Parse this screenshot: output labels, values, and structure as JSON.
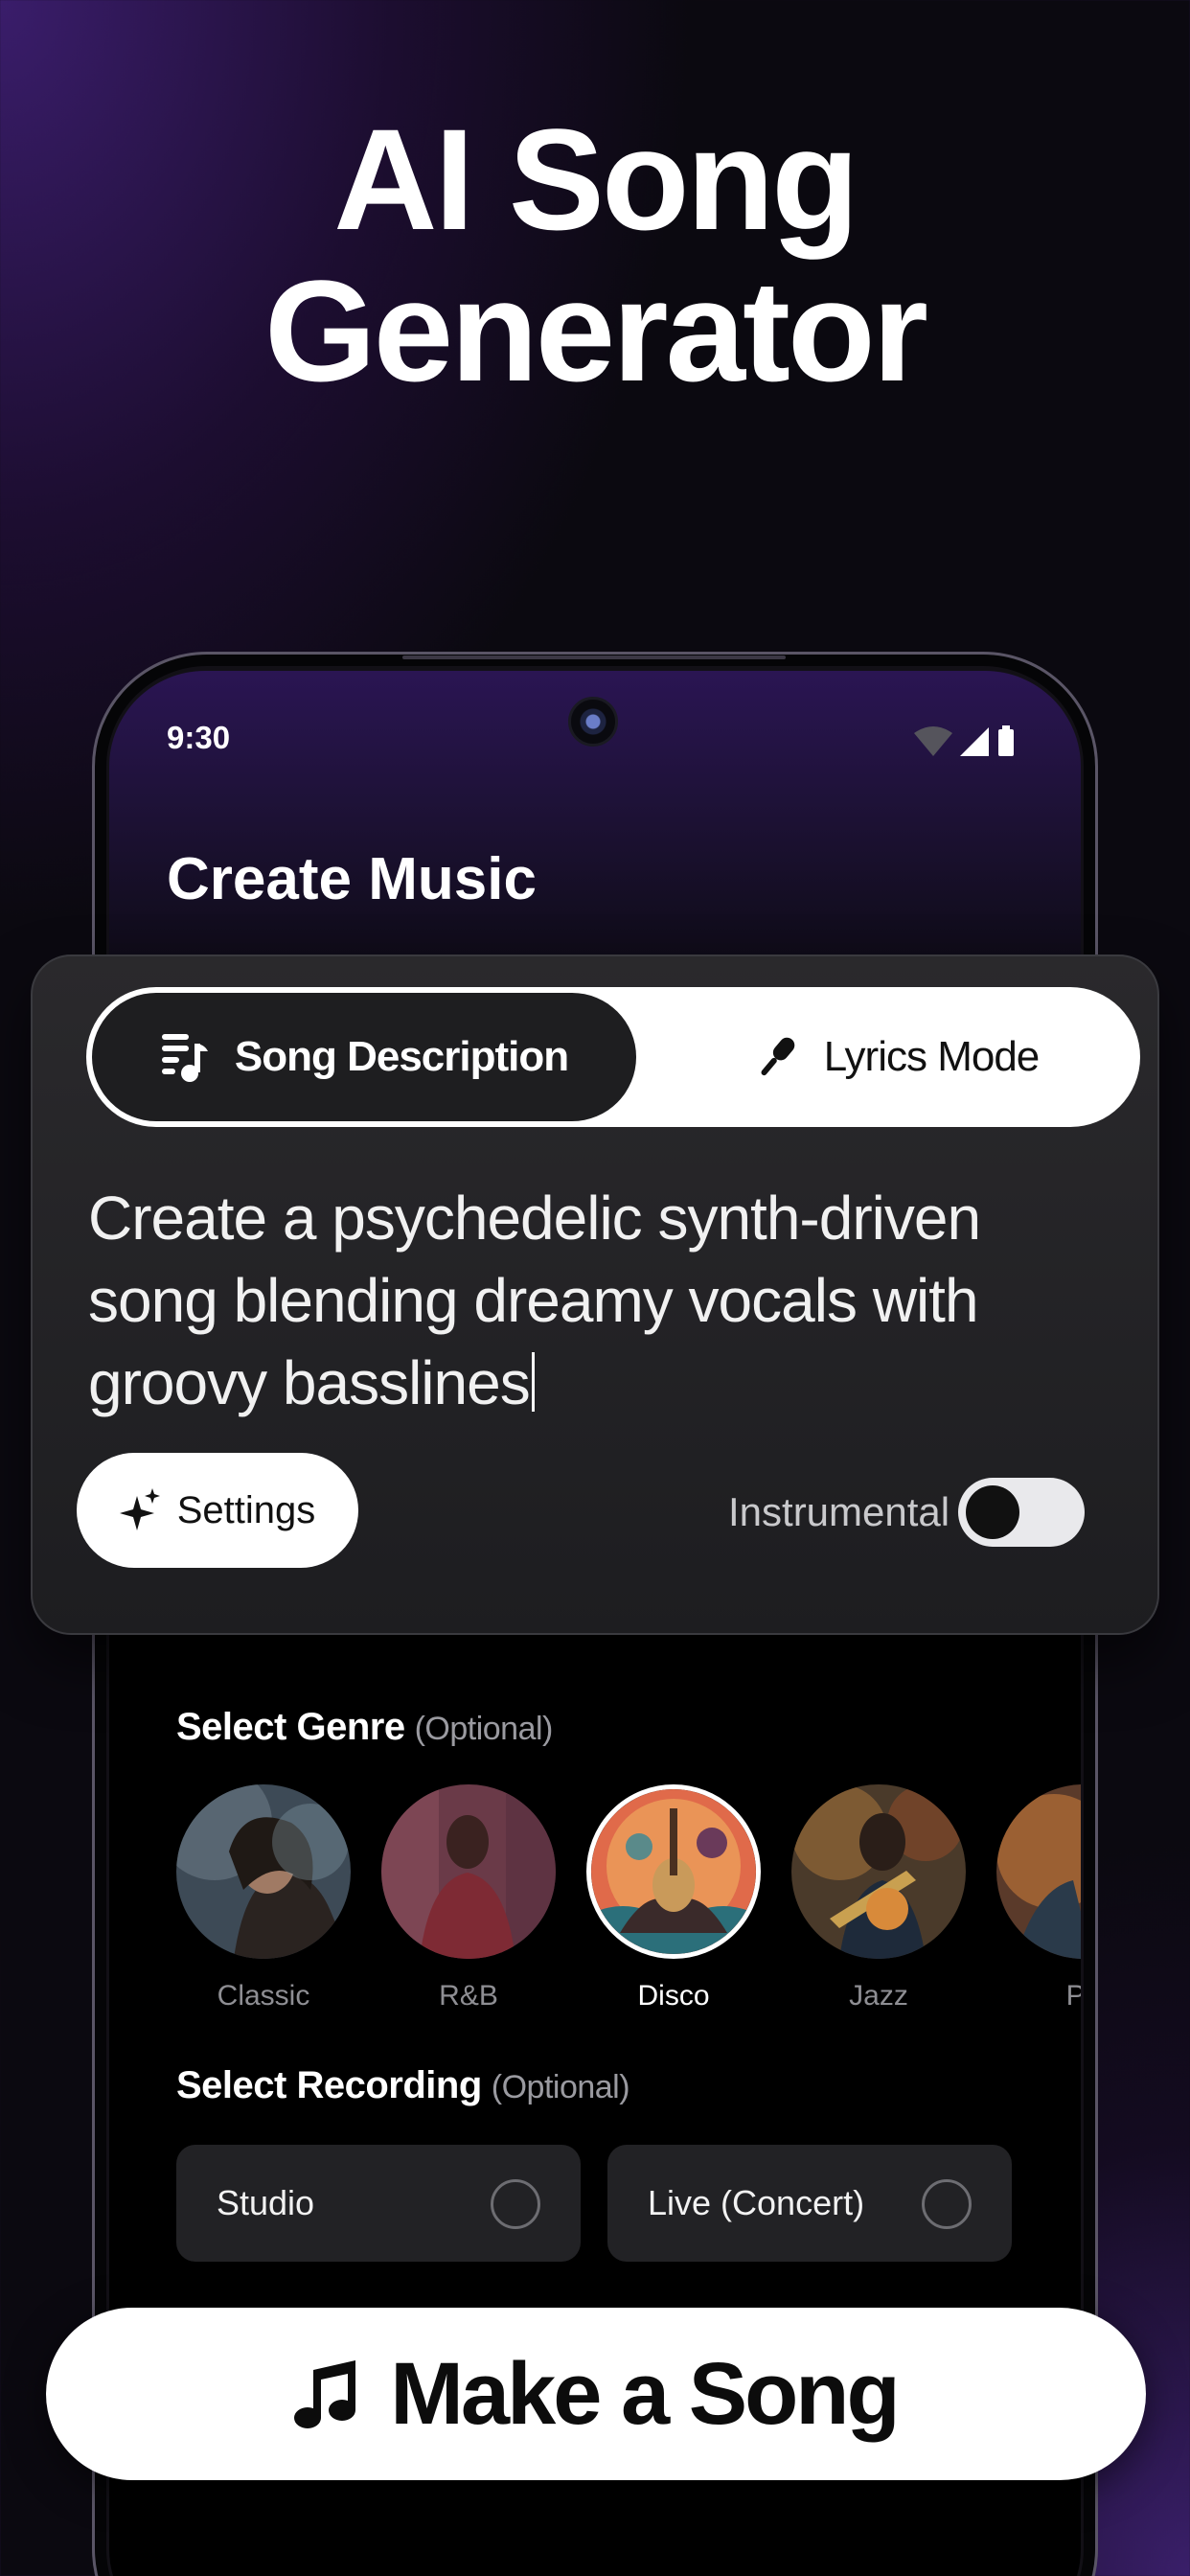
{
  "headline": {
    "line1": "AI Song",
    "line2": "Generator"
  },
  "status_bar": {
    "time": "9:30",
    "icons": [
      "wifi-icon",
      "signal-icon",
      "battery-icon"
    ]
  },
  "app": {
    "title": "Create Music"
  },
  "mode_tabs": {
    "active": "Song Description",
    "inactive": "Lyrics Mode",
    "active_icon": "lyrics-music-icon",
    "inactive_icon": "microphone-icon"
  },
  "prompt": {
    "line1": "Create a psychedelic synth-driven",
    "line2": "song blending dreamy vocals with",
    "line3": "groovy basslines"
  },
  "settings_button": {
    "label": "Settings",
    "icon": "sparkle-icon"
  },
  "instrumental": {
    "label": "Instrumental",
    "enabled": false
  },
  "genre_section": {
    "title": "Select Genre",
    "optional": "(Optional)",
    "selected": "Disco",
    "items": [
      {
        "name": "Classic"
      },
      {
        "name": "R&B"
      },
      {
        "name": "Disco"
      },
      {
        "name": "Jazz"
      },
      {
        "name": "Po"
      }
    ]
  },
  "recording_section": {
    "title": "Select Recording",
    "optional": "(Optional)",
    "options": [
      {
        "label": "Studio",
        "selected": false
      },
      {
        "label": "Live (Concert)",
        "selected": false
      }
    ]
  },
  "make_button": {
    "label": "Make a Song",
    "icon": "music-note-icon"
  },
  "colors": {
    "background": "#0b0910",
    "purple_glow": "#3a1d6b",
    "card": "#2a292c",
    "button_white": "#ffffff"
  }
}
